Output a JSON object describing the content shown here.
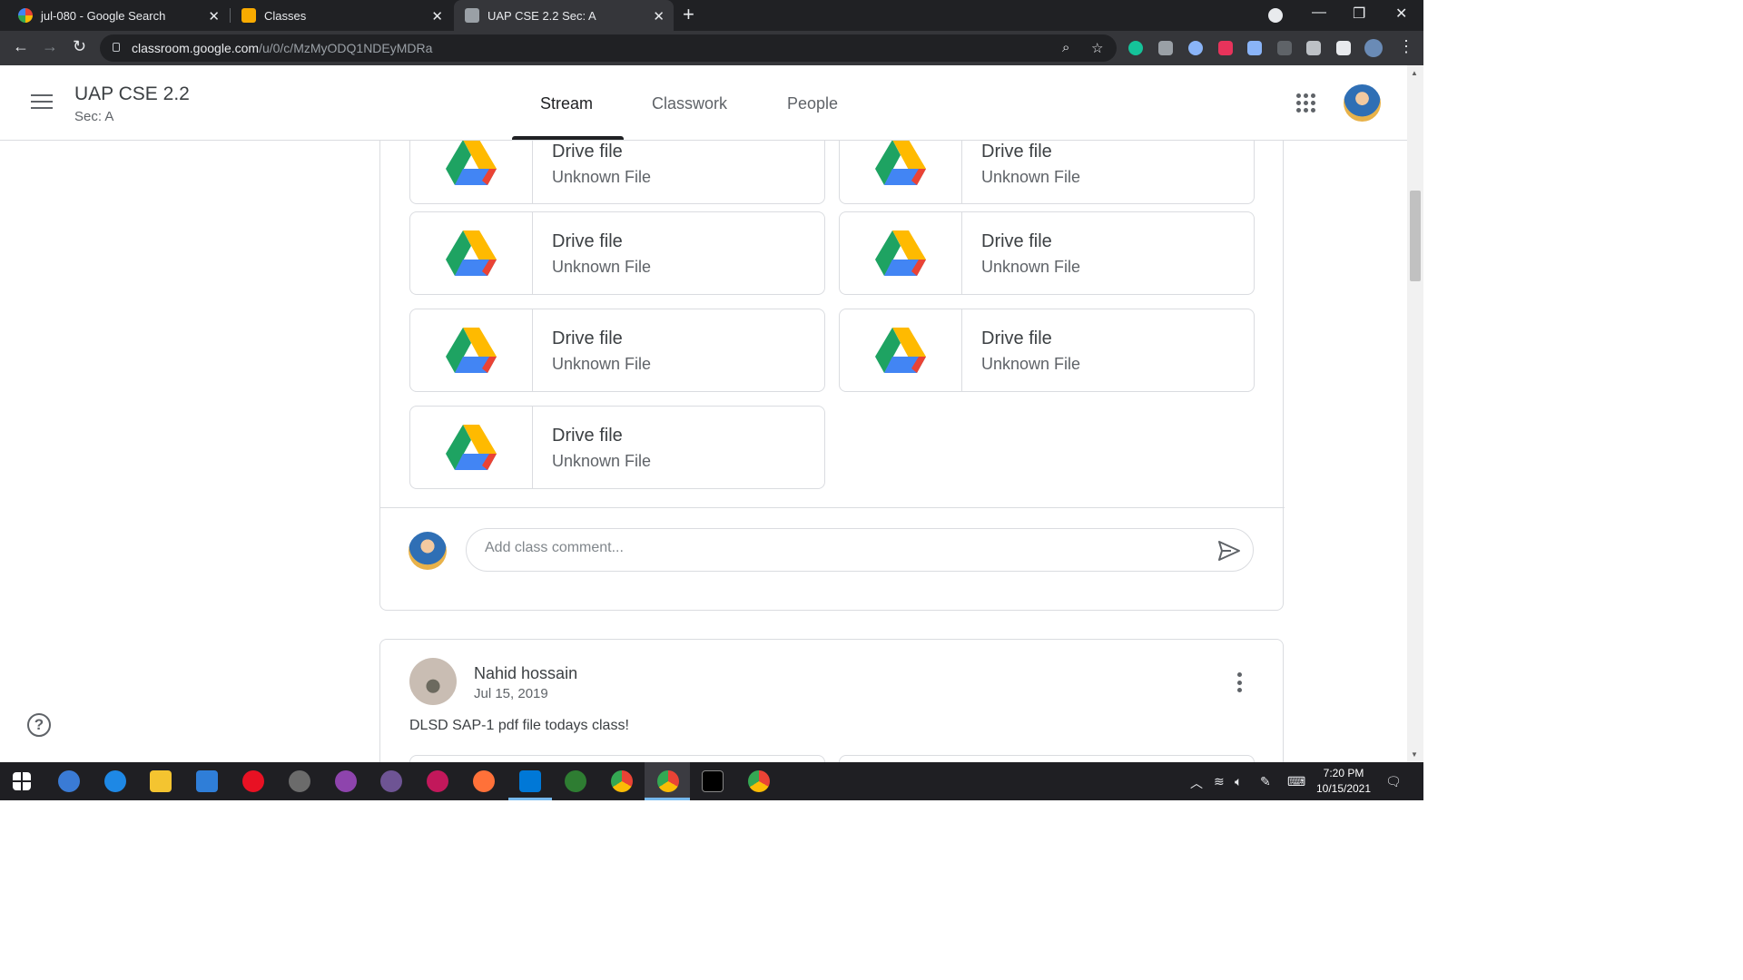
{
  "browser": {
    "tabs": [
      {
        "title": "jul-080 - Google Search",
        "active": false
      },
      {
        "title": "Classes",
        "active": false
      },
      {
        "title": "UAP CSE 2.2 Sec: A",
        "active": true
      }
    ],
    "url_host": "classroom.google.com",
    "url_path": "/u/0/c/MzMyODQ1NDEyMDRa"
  },
  "header": {
    "class_title": "UAP CSE 2.2",
    "class_section": "Sec: A",
    "tabs": [
      {
        "label": "Stream",
        "active": true
      },
      {
        "label": "Classwork",
        "active": false
      },
      {
        "label": "People",
        "active": false
      }
    ]
  },
  "attachments": [
    {
      "title": "Drive file",
      "subtitle": "Unknown File"
    },
    {
      "title": "Drive file",
      "subtitle": "Unknown File"
    },
    {
      "title": "Drive file",
      "subtitle": "Unknown File"
    },
    {
      "title": "Drive file",
      "subtitle": "Unknown File"
    },
    {
      "title": "Drive file",
      "subtitle": "Unknown File"
    },
    {
      "title": "Drive file",
      "subtitle": "Unknown File"
    },
    {
      "title": "Drive file",
      "subtitle": "Unknown File"
    }
  ],
  "comment": {
    "placeholder": "Add class comment..."
  },
  "next_post": {
    "author": "Nahid hossain",
    "date": "Jul 15, 2019",
    "text": "DLSD SAP-1 pdf file todays class!"
  },
  "taskbar": {
    "time": "7:20 PM",
    "date": "10/15/2021"
  },
  "colors": {
    "drive_green": "#1ea362",
    "drive_yellow": "#ffba00",
    "drive_blue": "#4285f4",
    "drive_red": "#ea4335",
    "active_tab_underline": "#202124"
  },
  "icons": [
    "hamburger-icon",
    "apps-grid-icon",
    "send-icon",
    "help-icon",
    "more-vert-icon",
    "google-drive-icon"
  ]
}
